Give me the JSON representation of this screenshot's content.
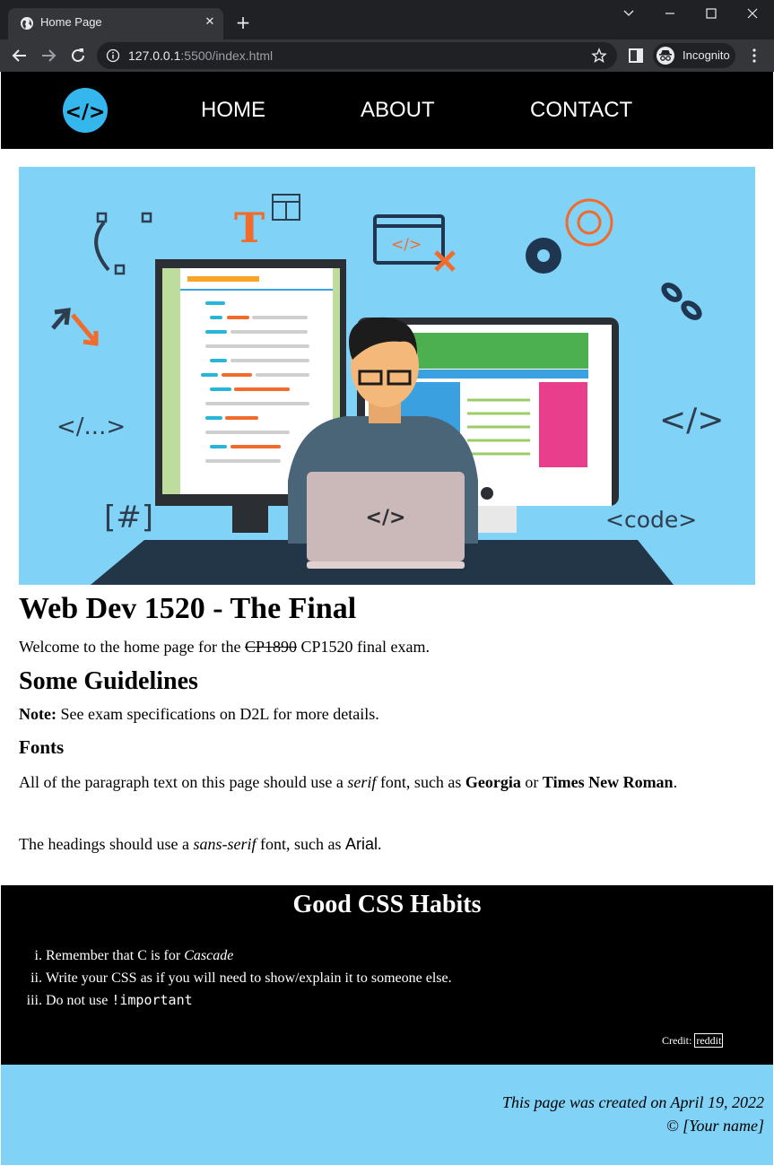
{
  "browser": {
    "tab_title": "Home Page",
    "new_tab_label": "+",
    "url_host": "127.0.0.1",
    "url_rest": ":5500/index.html",
    "incognito_label": "Incognito"
  },
  "nav": {
    "logo_text": "</>",
    "links": [
      "HOME",
      "ABOUT",
      "CONTACT"
    ]
  },
  "hero": {
    "monitor_text": "</>",
    "text_T": "T",
    "ellipsis_tag": "</...>",
    "code_tag": "</>",
    "hash_tag": "[#]",
    "code_word": "<code>",
    "laptop_text": "</>"
  },
  "main": {
    "title": "Web Dev 1520 - The Final",
    "welcome_pre": "Welcome to the home page for the ",
    "welcome_struck": "CP1890",
    "welcome_course": " CP1520",
    "welcome_post": " final exam.",
    "guidelines_heading": "Some Guidelines",
    "note_label": "Note:",
    "note_text": " See exam specifications on D2L for more details.",
    "fonts_heading": "Fonts",
    "fonts_p1_a": "All of the paragraph text on this page should use a ",
    "fonts_p1_serif": "serif",
    "fonts_p1_b": " font, such as ",
    "fonts_p1_georgia": "Georgia",
    "fonts_p1_or": " or ",
    "fonts_p1_tnr": "Times New Roman",
    "fonts_p1_end": ".",
    "fonts_p2_a": "The headings should use a ",
    "fonts_p2_sans": "sans-serif",
    "fonts_p2_b": " font, such as ",
    "fonts_p2_arial": "Arial",
    "fonts_p2_end": "."
  },
  "habits": {
    "heading": "Good CSS Habits",
    "item1_pre": "Remember that C is for ",
    "item1_em": "Cascade",
    "item2": "Write your CSS as if you will need to show/explain it to someone else.",
    "item3_pre": "Do not use ",
    "item3_code": "!important",
    "credit_label": "Credit: ",
    "credit_link": "reddit"
  },
  "footer": {
    "line1": "This page was created on April 19, 2022",
    "line2": "© [Your name]"
  },
  "colors": {
    "hero_bg": "#80d2f7",
    "logo_bg": "#35b6ec",
    "nav_bg": "#000000",
    "footer_bg": "#80d2f7"
  }
}
